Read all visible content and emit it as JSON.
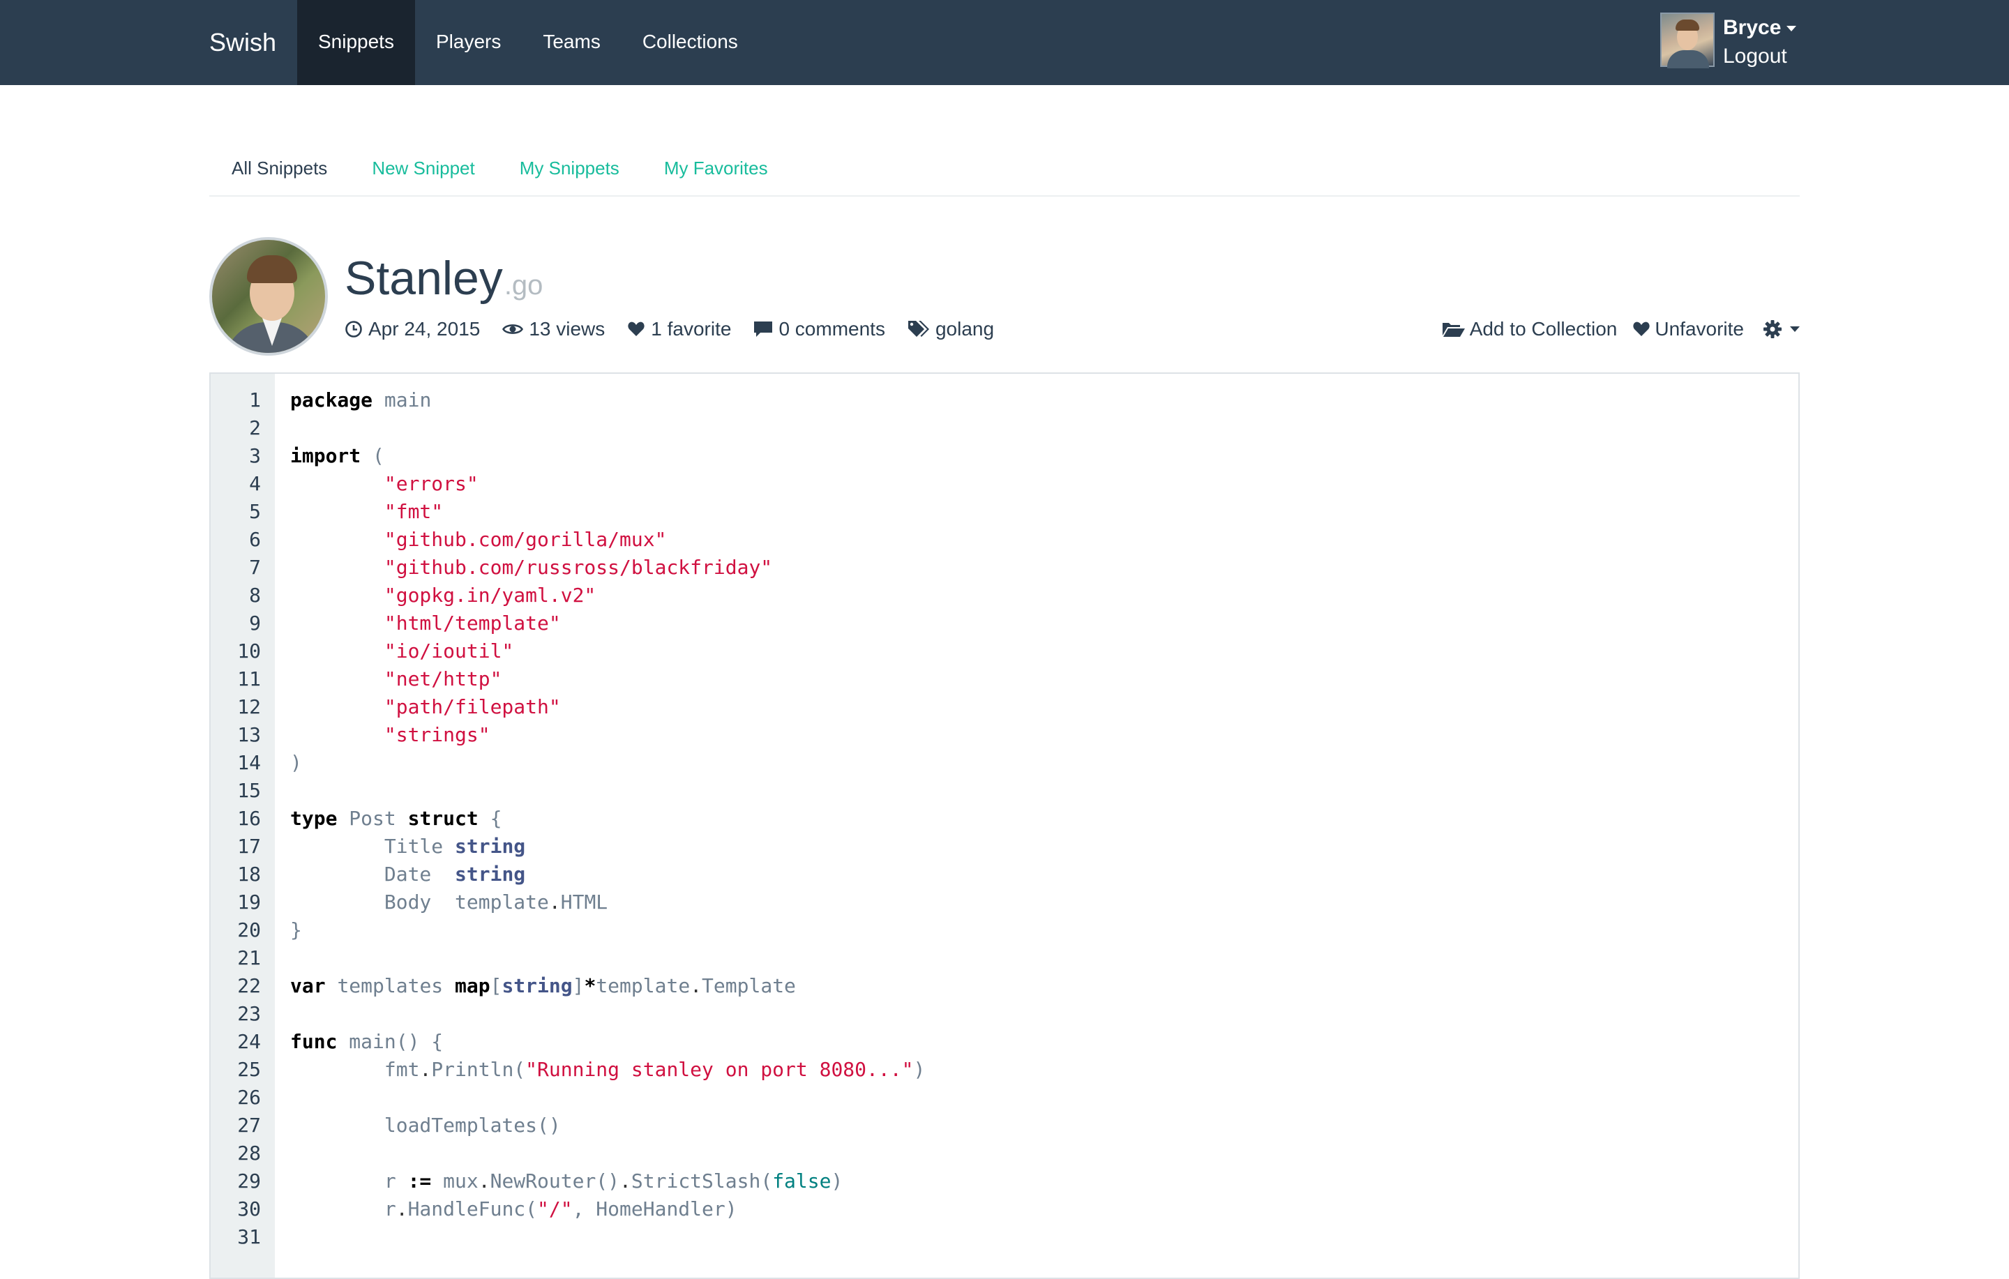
{
  "navbar": {
    "brand": "Swish",
    "links": [
      {
        "label": "Snippets",
        "active": true
      },
      {
        "label": "Players",
        "active": false
      },
      {
        "label": "Teams",
        "active": false
      },
      {
        "label": "Collections",
        "active": false
      }
    ],
    "user": {
      "name": "Bryce",
      "logout": "Logout"
    }
  },
  "subnav": {
    "items": [
      "All Snippets",
      "New Snippet",
      "My Snippets",
      "My Favorites"
    ],
    "current": "All Snippets"
  },
  "snippet": {
    "title": "Stanley",
    "extension": ".go",
    "date": "Apr 24, 2015",
    "views": "13 views",
    "favorites": "1 favorite",
    "comments": "0 comments",
    "tag": "golang",
    "actions": {
      "add_to_collection": "Add to Collection",
      "unfavorite": "Unfavorite"
    }
  },
  "colors": {
    "navbar": "#2c3e50",
    "navbar_active": "#1a242f",
    "accent": "#18bc9c",
    "gutter": "#ecf0f1",
    "string": "#d01040",
    "type": "#445588",
    "boolean": "#008080"
  },
  "code": {
    "language": "go",
    "lines": [
      [
        [
          "kw",
          "package"
        ],
        [
          "pun",
          " "
        ],
        [
          "id",
          "main"
        ]
      ],
      [],
      [
        [
          "kw",
          "import"
        ],
        [
          "pun",
          " "
        ],
        [
          "id",
          "("
        ]
      ],
      [
        [
          "pun",
          "\t"
        ],
        [
          "str",
          "\"errors\""
        ]
      ],
      [
        [
          "pun",
          "\t"
        ],
        [
          "str",
          "\"fmt\""
        ]
      ],
      [
        [
          "pun",
          "\t"
        ],
        [
          "str",
          "\"github.com/gorilla/mux\""
        ]
      ],
      [
        [
          "pun",
          "\t"
        ],
        [
          "str",
          "\"github.com/russross/blackfriday\""
        ]
      ],
      [
        [
          "pun",
          "\t"
        ],
        [
          "str",
          "\"gopkg.in/yaml.v2\""
        ]
      ],
      [
        [
          "pun",
          "\t"
        ],
        [
          "str",
          "\"html/template\""
        ]
      ],
      [
        [
          "pun",
          "\t"
        ],
        [
          "str",
          "\"io/ioutil\""
        ]
      ],
      [
        [
          "pun",
          "\t"
        ],
        [
          "str",
          "\"net/http\""
        ]
      ],
      [
        [
          "pun",
          "\t"
        ],
        [
          "str",
          "\"path/filepath\""
        ]
      ],
      [
        [
          "pun",
          "\t"
        ],
        [
          "str",
          "\"strings\""
        ]
      ],
      [
        [
          "id",
          ")"
        ]
      ],
      [],
      [
        [
          "kw",
          "type"
        ],
        [
          "pun",
          " "
        ],
        [
          "id",
          "Post"
        ],
        [
          "pun",
          " "
        ],
        [
          "kw",
          "struct"
        ],
        [
          "pun",
          " "
        ],
        [
          "id",
          "{"
        ]
      ],
      [
        [
          "pun",
          "\t"
        ],
        [
          "id",
          "Title"
        ],
        [
          "pun",
          " "
        ],
        [
          "type",
          "string"
        ]
      ],
      [
        [
          "pun",
          "\t"
        ],
        [
          "id",
          "Date"
        ],
        [
          "pun",
          "  "
        ],
        [
          "type",
          "string"
        ]
      ],
      [
        [
          "pun",
          "\t"
        ],
        [
          "id",
          "Body"
        ],
        [
          "pun",
          "  "
        ],
        [
          "id",
          "template"
        ],
        [
          "pun",
          "."
        ],
        [
          "id",
          "HTML"
        ]
      ],
      [
        [
          "id",
          "}"
        ]
      ],
      [],
      [
        [
          "kw",
          "var"
        ],
        [
          "pun",
          " "
        ],
        [
          "id",
          "templates"
        ],
        [
          "pun",
          " "
        ],
        [
          "kw",
          "map"
        ],
        [
          "id",
          "["
        ],
        [
          "type",
          "string"
        ],
        [
          "id",
          "]"
        ],
        [
          "op",
          "*"
        ],
        [
          "id",
          "template"
        ],
        [
          "pun",
          "."
        ],
        [
          "id",
          "Template"
        ]
      ],
      [],
      [
        [
          "kw",
          "func"
        ],
        [
          "pun",
          " "
        ],
        [
          "id",
          "main() {"
        ]
      ],
      [
        [
          "pun",
          "\t"
        ],
        [
          "id",
          "fmt"
        ],
        [
          "pun",
          "."
        ],
        [
          "id",
          "Println("
        ],
        [
          "str",
          "\"Running stanley on port 8080...\""
        ],
        [
          "id",
          ")"
        ]
      ],
      [],
      [
        [
          "pun",
          "\t"
        ],
        [
          "id",
          "loadTemplates()"
        ]
      ],
      [],
      [
        [
          "pun",
          "\t"
        ],
        [
          "id",
          "r"
        ],
        [
          "pun",
          " "
        ],
        [
          "op",
          ":="
        ],
        [
          "pun",
          " "
        ],
        [
          "id",
          "mux"
        ],
        [
          "pun",
          "."
        ],
        [
          "id",
          "NewRouter()"
        ],
        [
          "pun",
          "."
        ],
        [
          "id",
          "StrictSlash("
        ],
        [
          "bool",
          "false"
        ],
        [
          "id",
          ")"
        ]
      ],
      [
        [
          "pun",
          "\t"
        ],
        [
          "id",
          "r"
        ],
        [
          "pun",
          "."
        ],
        [
          "id",
          "HandleFunc("
        ],
        [
          "str",
          "\"/\""
        ],
        [
          "id",
          ", HomeHandler)"
        ]
      ],
      []
    ]
  }
}
